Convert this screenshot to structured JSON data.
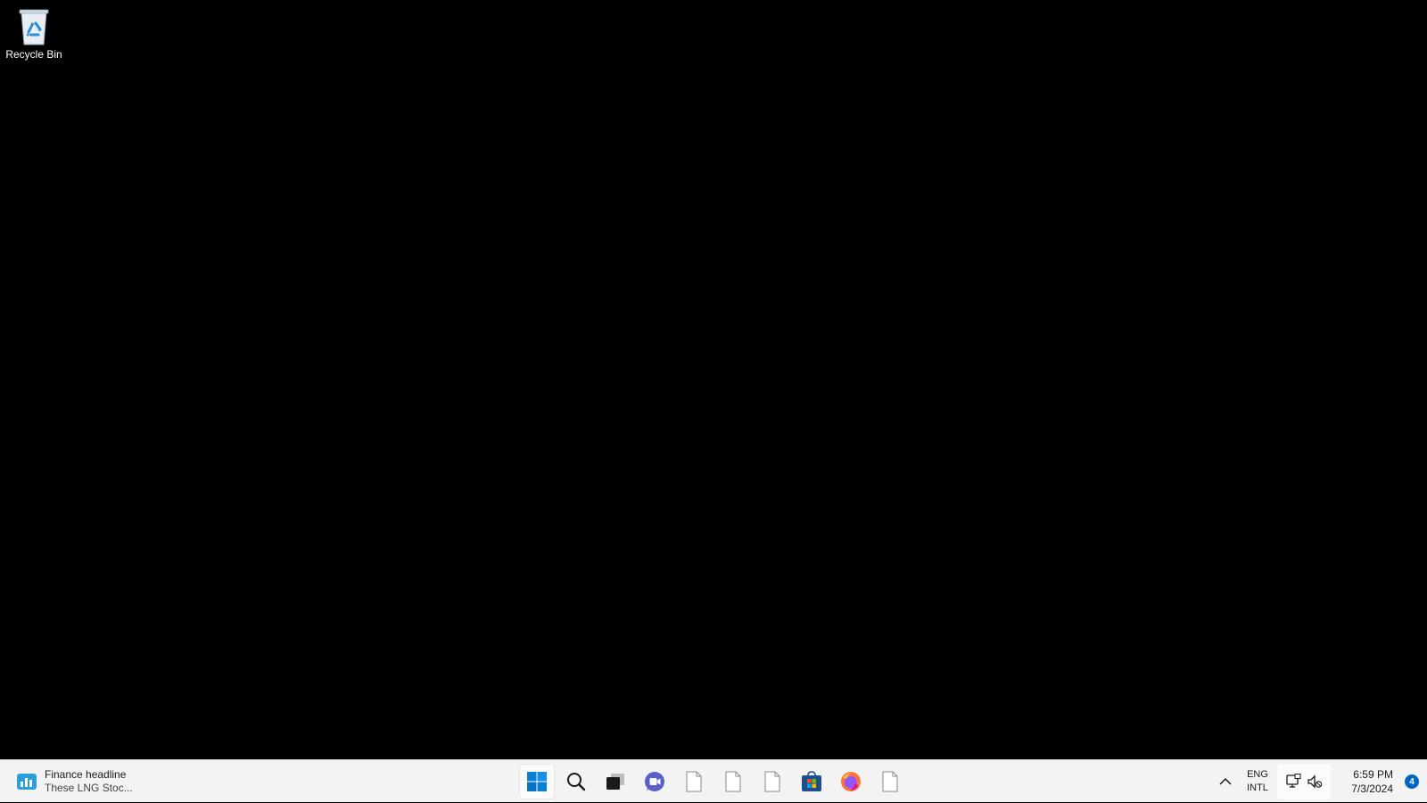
{
  "desktop": {
    "icons": [
      {
        "label": "Recycle Bin",
        "icon": "recycle-bin-icon"
      }
    ]
  },
  "taskbar": {
    "widget": {
      "title": "Finance headline",
      "subtitle": "These LNG Stoc...",
      "icon": "finance-widget-icon"
    },
    "apps": [
      {
        "name": "start",
        "icon": "windows-start-icon"
      },
      {
        "name": "search",
        "icon": "search-icon"
      },
      {
        "name": "task-view",
        "icon": "task-view-icon"
      },
      {
        "name": "chat",
        "icon": "teams-chat-icon"
      },
      {
        "name": "file-1",
        "icon": "blank-file-icon"
      },
      {
        "name": "file-2",
        "icon": "blank-file-icon"
      },
      {
        "name": "file-3",
        "icon": "blank-file-icon"
      },
      {
        "name": "store",
        "icon": "microsoft-store-icon"
      },
      {
        "name": "firefox",
        "icon": "firefox-icon"
      },
      {
        "name": "file-4",
        "icon": "blank-file-icon"
      }
    ],
    "tray": {
      "lang_top": "ENG",
      "lang_bottom": "INTL",
      "time": "6:59 PM",
      "date": "7/3/2024",
      "notification_count": "4"
    }
  },
  "colors": {
    "desktop_bg": "#000000",
    "taskbar_bg": "#f3f3f3",
    "accent": "#0067c0"
  }
}
